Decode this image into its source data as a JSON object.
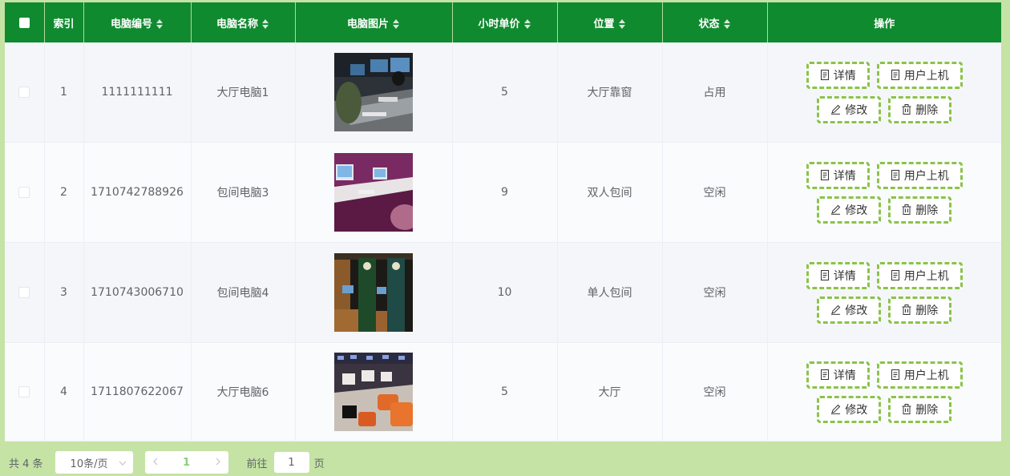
{
  "table": {
    "headers": {
      "index": "索引",
      "code": "电脑编号",
      "name": "电脑名称",
      "image": "电脑图片",
      "price": "小时单价",
      "location": "位置",
      "status": "状态",
      "actions": "操作"
    },
    "rows": [
      {
        "index": "1",
        "code": "1111111111",
        "name": "大厅电脑1",
        "price": "5",
        "location": "大厅靠窗",
        "status": "占用"
      },
      {
        "index": "2",
        "code": "1710742788926",
        "name": "包间电脑3",
        "price": "9",
        "location": "双人包间",
        "status": "空闲"
      },
      {
        "index": "3",
        "code": "1710743006710",
        "name": "包间电脑4",
        "price": "10",
        "location": "单人包间",
        "status": "空闲"
      },
      {
        "index": "4",
        "code": "1711807622067",
        "name": "大厅电脑6",
        "price": "5",
        "location": "大厅",
        "status": "空闲"
      }
    ],
    "actions": {
      "detail": "详情",
      "user_login": "用户上机",
      "edit": "修改",
      "delete": "删除"
    }
  },
  "pagination": {
    "total": "共 4 条",
    "page_size": "10条/页",
    "current_page": "1",
    "goto_label": "前往",
    "goto_value": "1",
    "page_unit": "页"
  },
  "colors": {
    "header_bg": "#108a2f",
    "page_bg": "#c5e3a5",
    "button_border": "#8bc34a",
    "active_page": "#8bd07a"
  },
  "icons": {
    "detail": "document-icon",
    "user_login": "document-icon",
    "edit": "pencil-icon",
    "delete": "trash-icon",
    "sort": "sort-caret-icon",
    "prev": "chevron-left-icon",
    "next": "chevron-right-icon",
    "select": "chevron-down-icon"
  }
}
